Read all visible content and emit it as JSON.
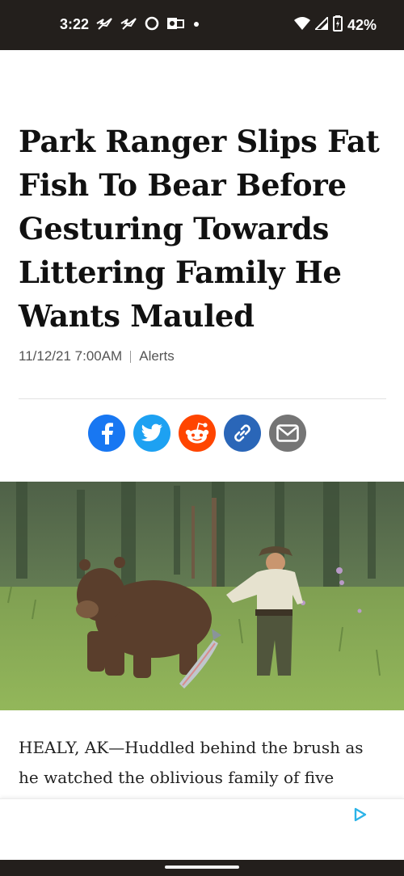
{
  "status_bar": {
    "time": "3:22",
    "battery": "42%",
    "icons": [
      "bird-icon",
      "bird-icon",
      "circle-icon",
      "outlook-icon",
      "dot-icon",
      "wifi-icon",
      "signal-icon",
      "battery-icon"
    ]
  },
  "article": {
    "headline": "Park Ranger Slips Fat Fish To Bear Before Gesturing Towards Littering Family He Wants Mauled",
    "date": "11/12/21 7:00AM",
    "section": "Alerts",
    "body_preview": "HEALY, AK—Huddled behind the brush as he watched the oblivious family of five"
  },
  "share": {
    "buttons": [
      "facebook",
      "twitter",
      "reddit",
      "copy-link",
      "email"
    ],
    "colors": {
      "facebook": "#1877f2",
      "twitter": "#1da1f2",
      "reddit": "#ff4500",
      "copy_link": "#2a66b8",
      "email": "#757575"
    }
  },
  "ad": {
    "icon": "adchoices-icon",
    "accent": "#2bb3e8"
  }
}
